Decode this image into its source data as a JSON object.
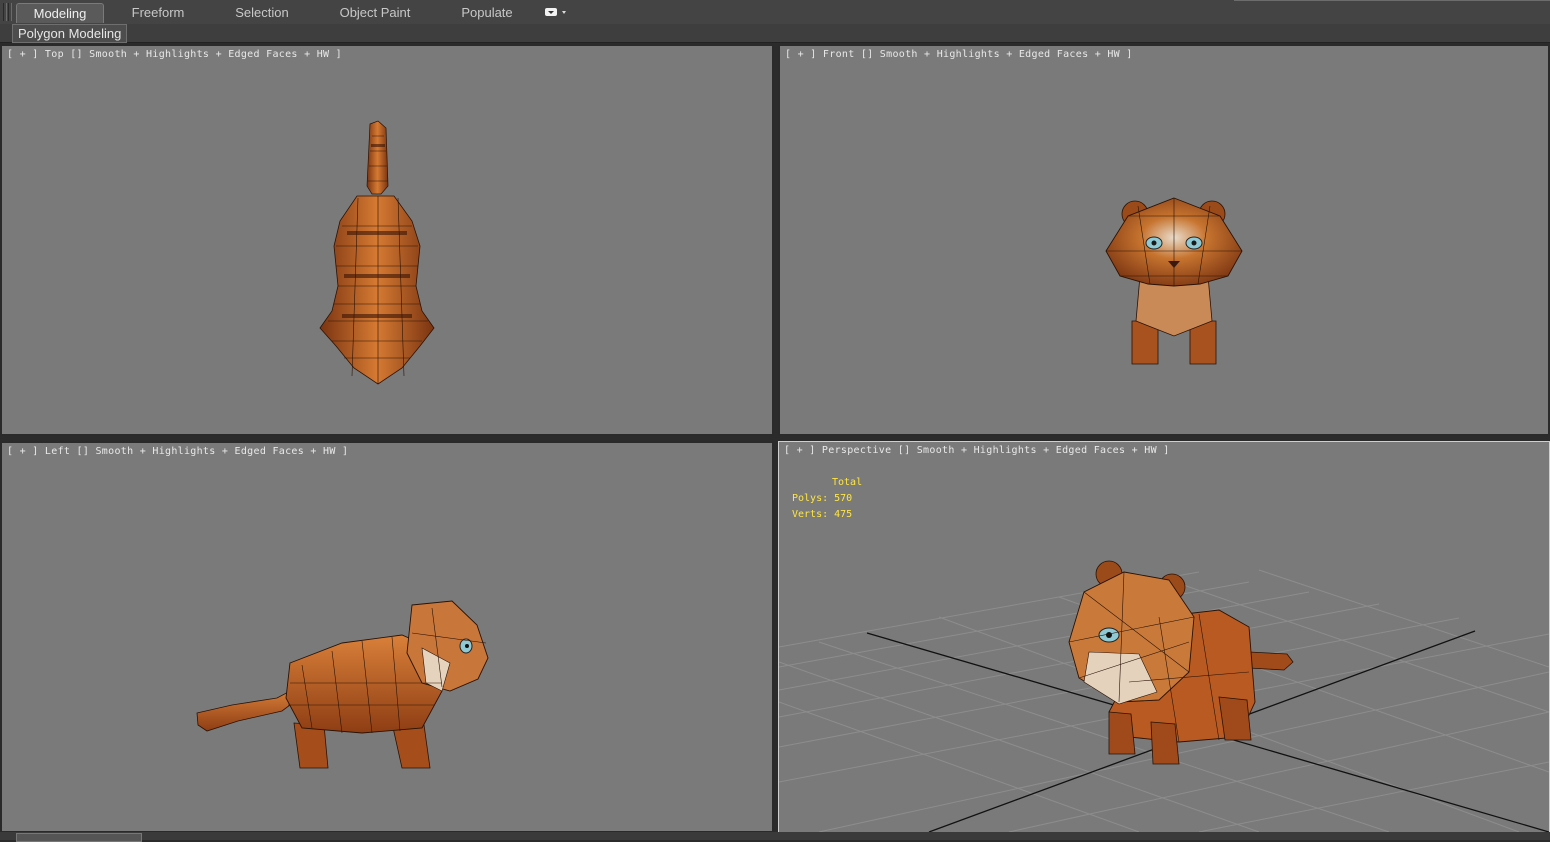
{
  "ribbon": {
    "tabs": [
      {
        "label": "Modeling",
        "active": true
      },
      {
        "label": "Freeform",
        "active": false
      },
      {
        "label": "Selection",
        "active": false
      },
      {
        "label": "Object Paint",
        "active": false
      },
      {
        "label": "Populate",
        "active": false
      }
    ],
    "dropdown_icon": "ribbon-options-icon",
    "panel_label": "Polygon Modeling"
  },
  "viewports": {
    "top": {
      "label": "[ + ] Top [] Smooth + Highlights + Edged Faces + HW ]"
    },
    "front": {
      "label": "[ + ] Front [] Smooth + Highlights + Edged Faces + HW ]"
    },
    "left": {
      "label": "[ + ] Left [] Smooth + Highlights + Edged Faces + HW ]"
    },
    "perspective": {
      "label": "[ + ] Perspective [] Smooth + Highlights + Edged Faces + HW ]"
    }
  },
  "stats": {
    "total": "Total",
    "polys": "Polys: 570",
    "verts": "Verts: 475"
  },
  "colors": {
    "viewport_bg": "#7a7a7a",
    "stats_text": "#ffe640",
    "tiger_orange": "#b9581f"
  },
  "icons": [
    "ribbon-options-icon"
  ]
}
